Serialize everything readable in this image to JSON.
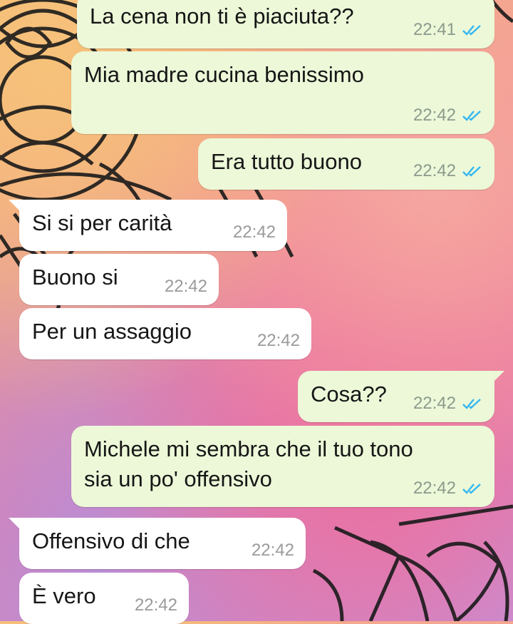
{
  "messages": [
    {
      "dir": "out",
      "text": "La cena non ti è piaciuta??",
      "time": "22:41",
      "read": true
    },
    {
      "dir": "out",
      "text": "Mia madre cucina benissimo",
      "time": "22:42",
      "read": true
    },
    {
      "dir": "out",
      "text": "Era tutto buono",
      "time": "22:42",
      "read": true
    },
    {
      "dir": "in",
      "text": "Si si per carità",
      "time": "22:42"
    },
    {
      "dir": "in",
      "text": "Buono si",
      "time": "22:42"
    },
    {
      "dir": "in",
      "text": "Per un assaggio",
      "time": "22:42"
    },
    {
      "dir": "out",
      "text": "Cosa??",
      "time": "22:42",
      "read": true
    },
    {
      "dir": "out",
      "text": "Michele mi sembra che il tuo tono\nsia un po' offensivo",
      "time": "22:42",
      "read": true
    },
    {
      "dir": "in",
      "text": "Offensivo di che",
      "time": "22:42"
    },
    {
      "dir": "in",
      "text": "È vero",
      "time": "22:42"
    }
  ],
  "colors": {
    "outgoing_bubble": "#ecf8d8",
    "incoming_bubble": "#ffffff",
    "read_check": "#34b7f1"
  },
  "icons": {
    "read_receipt": "double-check-icon"
  }
}
